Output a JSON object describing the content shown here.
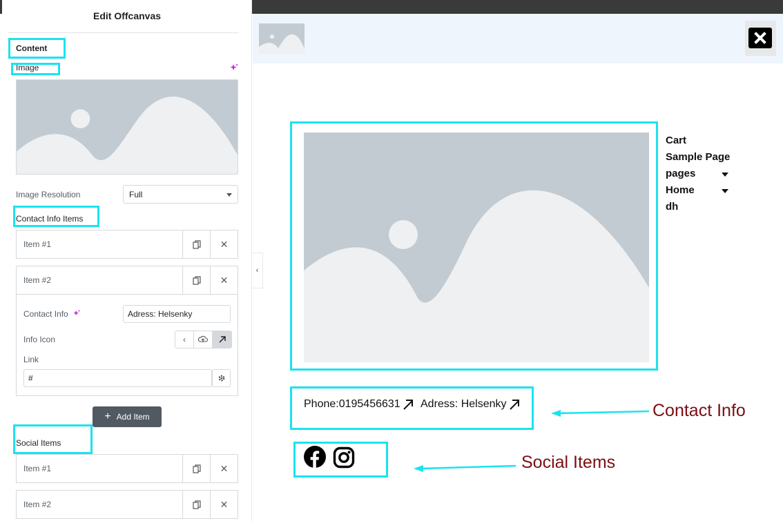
{
  "panel": {
    "title": "Edit Offcanvas",
    "content_label": "Content",
    "image_label": "Image",
    "image_resolution_label": "Image Resolution",
    "image_resolution_value": "Full",
    "contact_info_items_label": "Contact Info Items",
    "contact_items": [
      {
        "title": "Item #1"
      },
      {
        "title": "Item #2"
      }
    ],
    "expanded_item": {
      "contact_info_label": "Contact Info",
      "contact_info_value": "Adress: Helsenky",
      "info_icon_label": "Info Icon",
      "link_label": "Link",
      "link_value": "#"
    },
    "add_item_label": "Add Item",
    "social_items_label": "Social Items",
    "social_items": [
      {
        "title": "Item #1"
      },
      {
        "title": "Item #2"
      }
    ]
  },
  "preview": {
    "nav": [
      {
        "label": "Cart",
        "has_submenu": false
      },
      {
        "label": "Sample Page",
        "has_submenu": false
      },
      {
        "label": "pages",
        "has_submenu": true
      },
      {
        "label": "Home",
        "has_submenu": true
      },
      {
        "label": "dh",
        "has_submenu": false
      }
    ],
    "contacts": [
      {
        "text": "Phone:0195456631"
      },
      {
        "text": "Adress: Helsenky"
      }
    ],
    "social_icons": [
      "facebook-icon",
      "instagram-icon"
    ]
  },
  "annotations": {
    "contact_info": "Contact Info",
    "social_items": "Social Items"
  },
  "colors": {
    "highlight": "#1ae3ef",
    "annotation_text": "#7b0f14",
    "annotation_arrow": "#1ae3ef",
    "ai_icon": "#c42bdd"
  }
}
